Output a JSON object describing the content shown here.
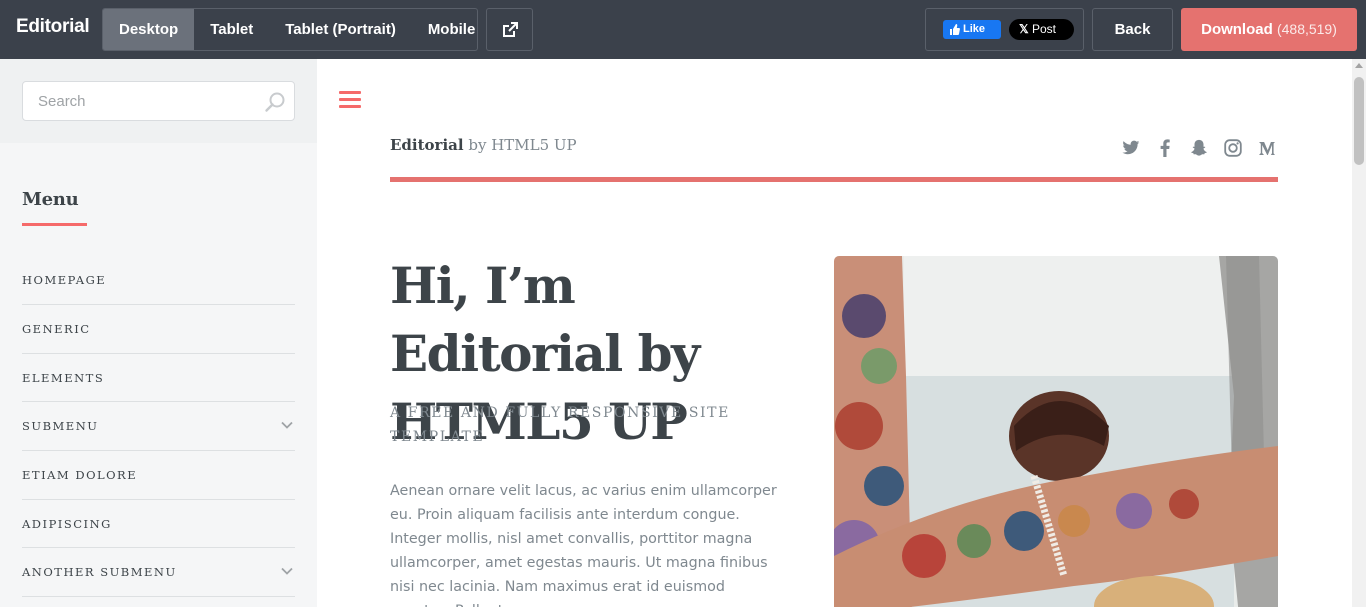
{
  "topbar": {
    "brand": "Editorial",
    "devices": [
      {
        "label": "Desktop",
        "active": true
      },
      {
        "label": "Tablet",
        "active": false
      },
      {
        "label": "Tablet (Portrait)",
        "active": false
      },
      {
        "label": "Mobile",
        "active": false
      }
    ],
    "external_icon": "external-link-icon",
    "fb_like_label": "Like",
    "x_post_label": "Post",
    "back_label": "Back",
    "download_label": "Download",
    "download_count": "(488,519)"
  },
  "sidebar": {
    "search_placeholder": "Search",
    "menu_title": "Menu",
    "items": [
      {
        "label": "Homepage",
        "has_submenu": false
      },
      {
        "label": "Generic",
        "has_submenu": false
      },
      {
        "label": "Elements",
        "has_submenu": false
      },
      {
        "label": "Submenu",
        "has_submenu": true
      },
      {
        "label": "Etiam Dolore",
        "has_submenu": false
      },
      {
        "label": "Adipiscing",
        "has_submenu": false
      },
      {
        "label": "Another Submenu",
        "has_submenu": true
      }
    ]
  },
  "main": {
    "logo_strong": "Editorial",
    "logo_rest": " by HTML5 UP",
    "social_icons": [
      "twitter-icon",
      "facebook-icon",
      "snapchat-icon",
      "instagram-icon",
      "medium-icon"
    ],
    "hero_title": "Hi, I’m Editorial by HTML5 UP",
    "hero_subtitle": "A free and fully responsive site template",
    "hero_body": "Aenean ornare velit lacus, ac varius enim ullamcorper eu. Proin aliquam facilisis ante interdum congue. Integer mollis, nisl amet convallis, porttitor magna ullamcorper, amet egestas mauris. Ut magna finibus nisi nec lacinia. Nam maximus erat id euismod egestas. Pellentesque"
  },
  "colors": {
    "topbar": "#3b414b",
    "accent": "#f56a6a",
    "download": "#e5726f",
    "text": "#3d4449",
    "muted": "#7f888f"
  }
}
